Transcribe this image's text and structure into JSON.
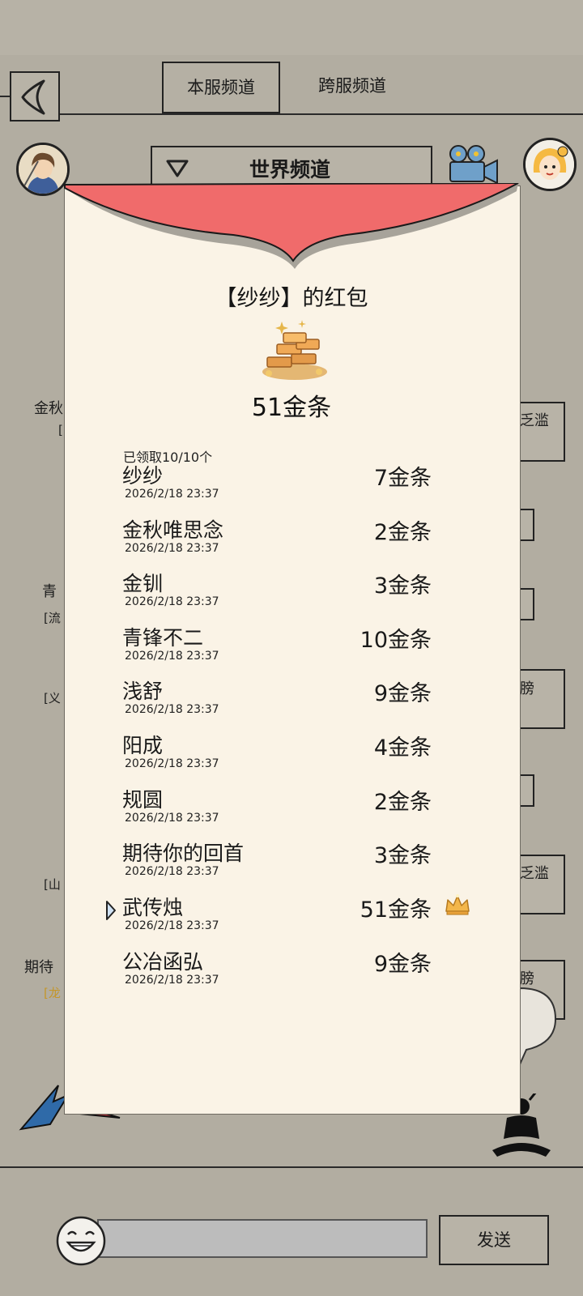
{
  "header": {
    "tabs": [
      {
        "label": "本服频道",
        "active": true
      },
      {
        "label": "跨服频道",
        "active": false
      }
    ],
    "channel_label": "世界频道"
  },
  "background_chat": {
    "fragments": [
      "金秋",
      "[",
      "青",
      "[流",
      "[义",
      "[山",
      "期待",
      "[龙",
      "乏滥",
      "乏滥",
      "膀",
      "膀"
    ]
  },
  "red_packet": {
    "title": "【纱纱】的红包",
    "total": "51金条",
    "claimed_text": "已领取10/10个",
    "entries": [
      {
        "name": "纱纱",
        "time": "2026/2/18 23:37",
        "amount": "7金条"
      },
      {
        "name": "金秋唯思念",
        "time": "2026/2/18 23:37",
        "amount": "2金条"
      },
      {
        "name": "金钏",
        "time": "2026/2/18 23:37",
        "amount": "3金条"
      },
      {
        "name": "青锋不二",
        "time": "2026/2/18 23:37",
        "amount": "10金条"
      },
      {
        "name": "浅舒",
        "time": "2026/2/18 23:37",
        "amount": "9金条"
      },
      {
        "name": "阳成",
        "time": "2026/2/18 23:37",
        "amount": "4金条"
      },
      {
        "name": "规圆",
        "time": "2026/2/18 23:37",
        "amount": "2金条"
      },
      {
        "name": "期待你的回首",
        "time": "2026/2/18 23:37",
        "amount": "3金条"
      },
      {
        "name": "武传烛",
        "time": "2026/2/18 23:37",
        "amount": "51金条",
        "is_self": true,
        "best_luck": true
      },
      {
        "name": "公冶函弘",
        "time": "2026/2/18 23:37",
        "amount": "9金条"
      }
    ]
  },
  "footer": {
    "send_label": "发送",
    "input_placeholder": ""
  },
  "colors": {
    "background": "#b2ada1",
    "modal_bg": "#faf3e6",
    "flap_red": "#f06b6b",
    "gold": "#c4962a"
  }
}
